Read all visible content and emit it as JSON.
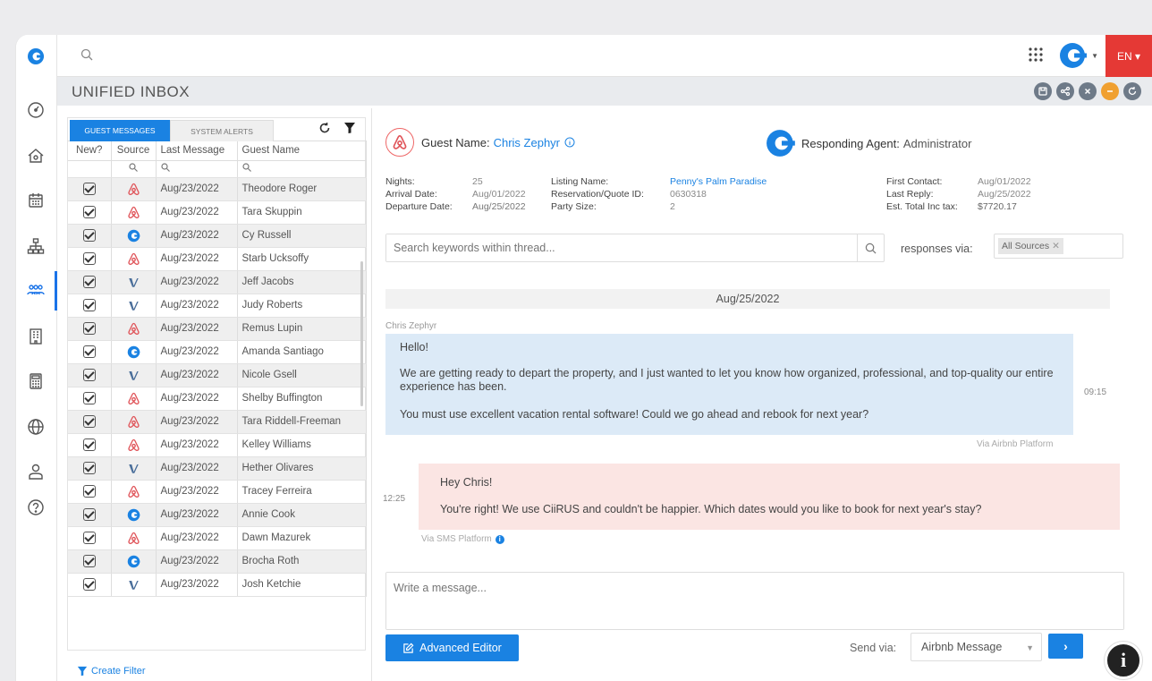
{
  "app": {
    "language": "EN"
  },
  "page": {
    "title": "UNIFIED INBOX"
  },
  "tabs": {
    "guest": "GUEST MESSAGES",
    "system": "SYSTEM ALERTS"
  },
  "columns": {
    "new": "New?",
    "source": "Source",
    "last_message": "Last Message",
    "guest_name": "Guest Name"
  },
  "rows": [
    {
      "source": "airbnb",
      "date": "Aug/23/2022",
      "name": "Theodore Roger"
    },
    {
      "source": "airbnb",
      "date": "Aug/23/2022",
      "name": "Tara Skuppin"
    },
    {
      "source": "ciirus",
      "date": "Aug/23/2022",
      "name": "Cy Russell"
    },
    {
      "source": "airbnb",
      "date": "Aug/23/2022",
      "name": "Starb Ucksoffy"
    },
    {
      "source": "vrbo",
      "date": "Aug/23/2022",
      "name": "Jeff Jacobs"
    },
    {
      "source": "vrbo",
      "date": "Aug/23/2022",
      "name": "Judy Roberts"
    },
    {
      "source": "airbnb",
      "date": "Aug/23/2022",
      "name": "Remus Lupin"
    },
    {
      "source": "ciirus",
      "date": "Aug/23/2022",
      "name": "Amanda Santiago"
    },
    {
      "source": "vrbo",
      "date": "Aug/23/2022",
      "name": "Nicole Gsell"
    },
    {
      "source": "airbnb",
      "date": "Aug/23/2022",
      "name": "Shelby Buffington"
    },
    {
      "source": "airbnb",
      "date": "Aug/23/2022",
      "name": "Tara Riddell-Freeman"
    },
    {
      "source": "airbnb",
      "date": "Aug/23/2022",
      "name": "Kelley Williams"
    },
    {
      "source": "vrbo",
      "date": "Aug/23/2022",
      "name": "Hether Olivares"
    },
    {
      "source": "airbnb",
      "date": "Aug/23/2022",
      "name": "Tracey Ferreira"
    },
    {
      "source": "ciirus",
      "date": "Aug/23/2022",
      "name": "Annie Cook"
    },
    {
      "source": "airbnb",
      "date": "Aug/23/2022",
      "name": "Dawn Mazurek"
    },
    {
      "source": "ciirus",
      "date": "Aug/23/2022",
      "name": "Brocha Roth"
    },
    {
      "source": "vrbo",
      "date": "Aug/23/2022",
      "name": "Josh Ketchie"
    }
  ],
  "create_filter": "Create Filter",
  "guest": {
    "label": "Guest Name:",
    "name": "Chris Zephyr"
  },
  "agent": {
    "label": "Responding Agent:",
    "name": "Administrator"
  },
  "reservation": {
    "nights_label": "Nights:",
    "nights": "25",
    "arrival_label": "Arrival Date:",
    "arrival": "Aug/01/2022",
    "departure_label": "Departure Date:",
    "departure": "Aug/25/2022",
    "listing_label": "Listing Name:",
    "listing": "Penny's Palm Paradise",
    "resid_label": "Reservation/Quote ID:",
    "resid": "0630318",
    "party_label": "Party Size:",
    "party": "2",
    "first_label": "First Contact:",
    "first": "Aug/01/2022",
    "last_label": "Last Reply:",
    "last": "Aug/25/2022",
    "total_label": "Est. Total Inc tax:",
    "total": "$7720.17"
  },
  "thread": {
    "search_placeholder": "Search keywords within thread...",
    "responses_label": "responses via:",
    "responses_chip": "All Sources",
    "date": "Aug/25/2022",
    "guest_sender": "Chris Zephyr",
    "guest_msg": [
      "Hello!",
      "We are getting ready to depart the property, and I just wanted to let you know how organized, professional, and top-quality our entire experience has been.",
      "You must use excellent vacation rental software! Could we go ahead and rebook for next year?"
    ],
    "guest_time": "09:15",
    "guest_via": "Via Airbnb Platform",
    "agent_msg": [
      "Hey Chris!",
      "You're right! We use CiiRUS and couldn't be happier. Which dates would you like to book for next year's stay?"
    ],
    "agent_time": "12:25",
    "agent_via": "Via SMS Platform"
  },
  "composer": {
    "placeholder": "Write a message...",
    "advanced": "Advanced Editor",
    "send_label": "Send via:",
    "send_option": "Airbnb Message"
  },
  "colors": {
    "accent": "#1a82e2",
    "lang_bg": "#e53935",
    "guest_bubble": "#dceaf7",
    "agent_bubble": "#fbe5e3"
  }
}
